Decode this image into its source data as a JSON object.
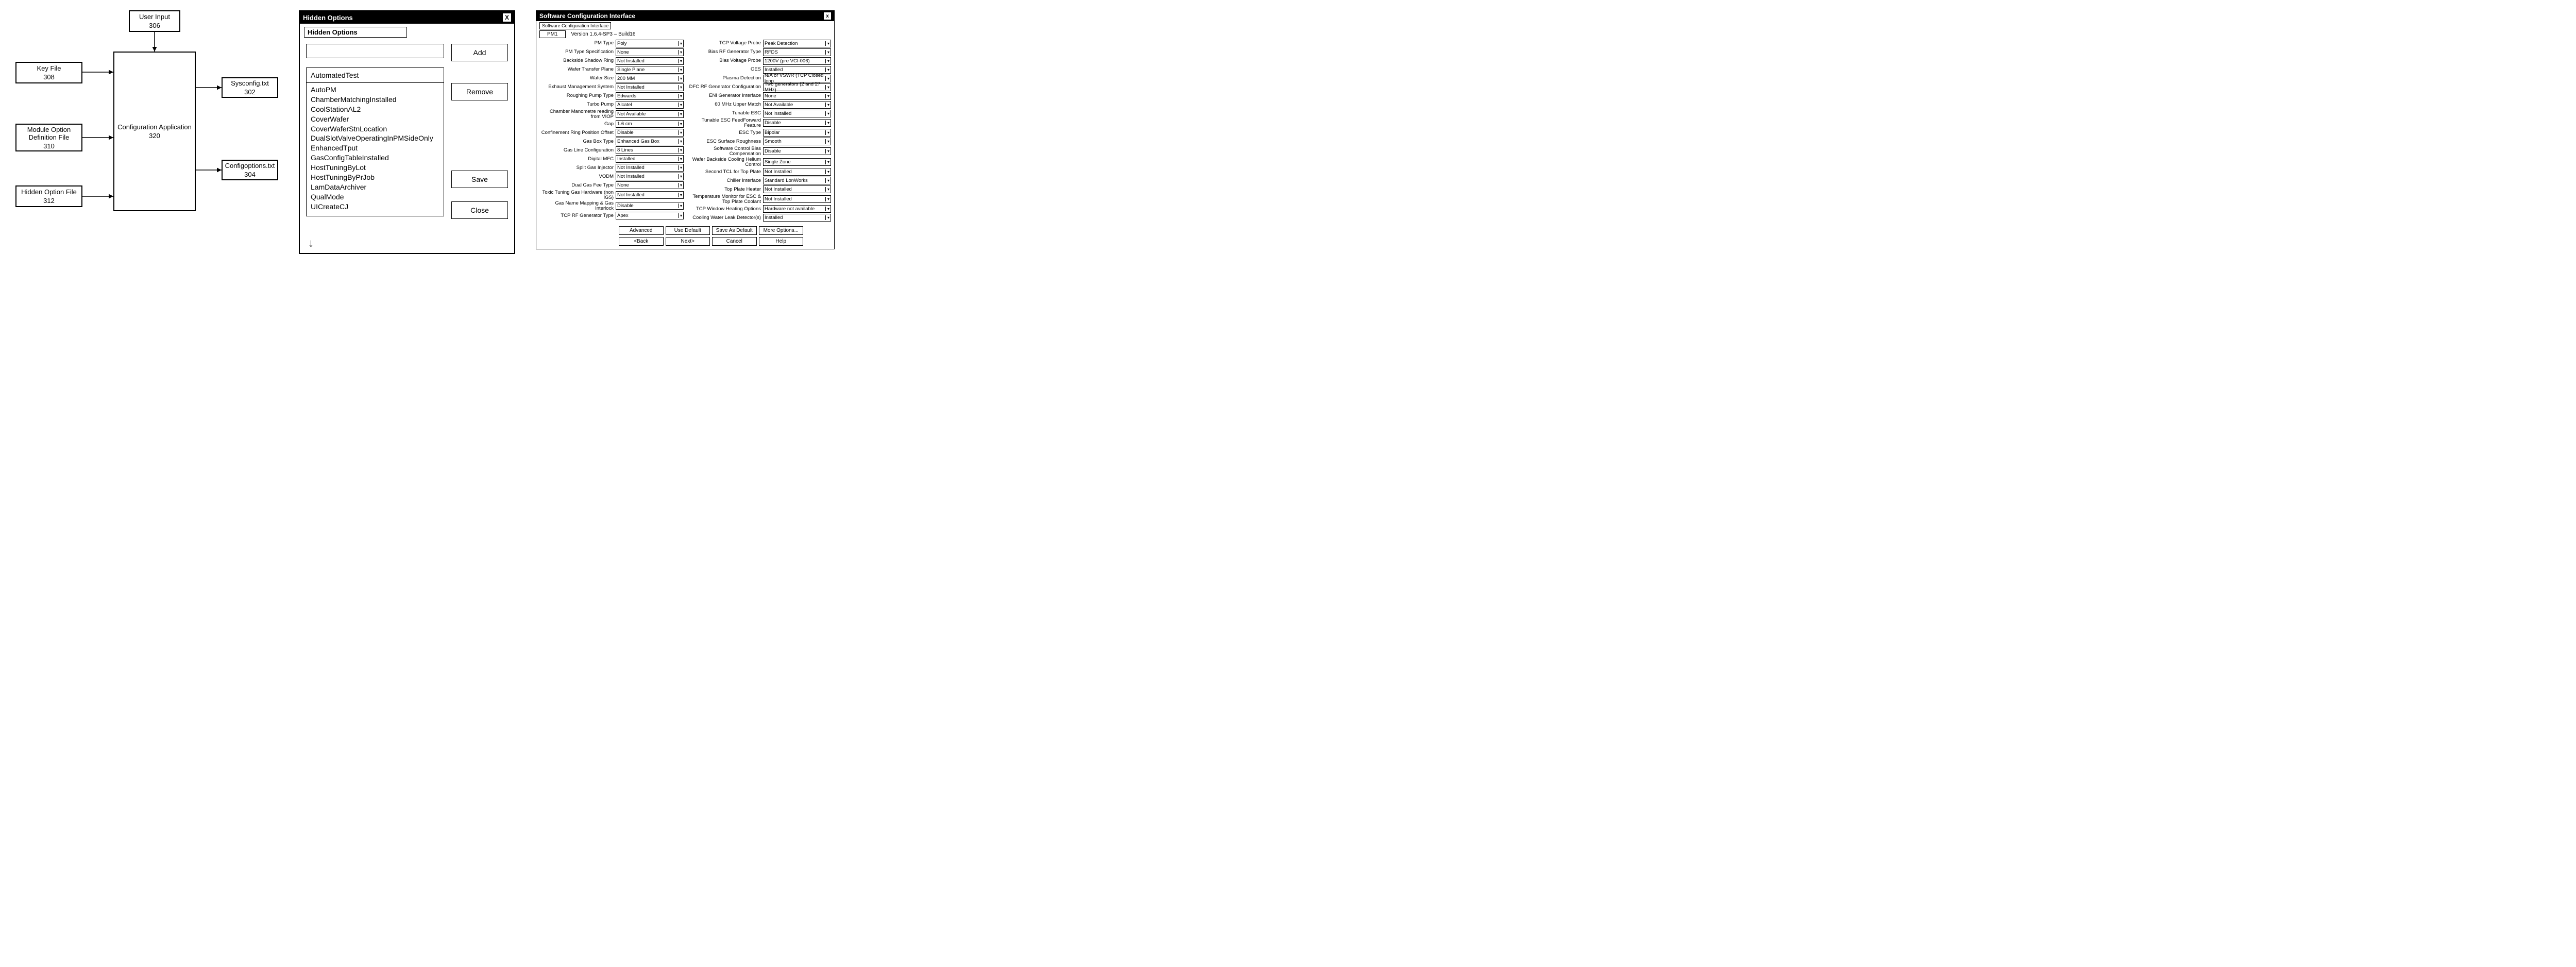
{
  "diagram": {
    "user_input": {
      "label": "User Input",
      "num": "306"
    },
    "key_file": {
      "label": "Key File",
      "num": "308"
    },
    "module_option": {
      "label": "Module Option\nDefinition File",
      "num": "310"
    },
    "hidden_option": {
      "label": "Hidden Option File",
      "num": "312"
    },
    "config_app": {
      "label": "Configuration Application",
      "num": "320"
    },
    "sysconfig": {
      "label": "Sysconfig.txt",
      "num": "302"
    },
    "configoptions": {
      "label": "Configoptions.txt",
      "num": "304"
    }
  },
  "hidden": {
    "title": "Hidden Options",
    "subtitle": "Hidden Options",
    "new_option_value": "",
    "selected": "AutomatedTest",
    "list": [
      "AutoPM",
      "ChamberMatchingInstalled",
      "CoolStationAL2",
      "CoverWafer",
      "CoverWaferStnLocation",
      "DualSlotValveOperatingInPMSideOnly",
      "EnhancedTput",
      "GasConfigTableInstalled",
      "HostTuningByLot",
      "HostTuningByPrJob",
      "LamDataArchiver",
      "QualMode",
      "UICreateCJ"
    ],
    "buttons": {
      "add": "Add",
      "remove": "Remove",
      "save": "Save",
      "close": "Close"
    }
  },
  "sci": {
    "title": "Software Configuration Interface",
    "tabbar_label": "Software Configuration Interface",
    "tab": "PM1",
    "version": "Version 1.6.4-SP3 – Build16",
    "left": [
      {
        "label": "PM Type",
        "value": "Poly"
      },
      {
        "label": "PM Type Specification",
        "value": "None"
      },
      {
        "label": "Backside Shadow Ring",
        "value": "Not Installed"
      },
      {
        "label": "Wafer Transfer Plane",
        "value": "Single Plane"
      },
      {
        "label": "Wafer Size",
        "value": "200 MM"
      },
      {
        "label": "Exhaust Management System",
        "value": "Not Installed"
      },
      {
        "label": "Roughing Pump Type",
        "value": "Edwards"
      },
      {
        "label": "Turbo Pump",
        "value": "Alcatel"
      },
      {
        "label": "Chamber Manometre reading from VIOP",
        "value": "Not Available"
      },
      {
        "label": "Gap",
        "value": "1.6 cm"
      },
      {
        "label": "Confinement Ring Position Offset",
        "value": "Disable"
      },
      {
        "label": "Gas Box Type",
        "value": "Enhanced Gas Box"
      },
      {
        "label": "Gas Line Configuration",
        "value": "8 Lines"
      },
      {
        "label": "Digital MFC",
        "value": "Installed"
      },
      {
        "label": "Split Gas Injector",
        "value": "Not Installed"
      },
      {
        "label": "VODM",
        "value": "Not Installed"
      },
      {
        "label": "Dual Gas Fee Type",
        "value": "None"
      },
      {
        "label": "Toxic Tuning Gas Hardware (non IGS)",
        "value": "Not Installed"
      },
      {
        "label": "Gas Name Mapping & Gas Interlock",
        "value": "Disable"
      },
      {
        "label": "TCP RF Generator Type",
        "value": "Apex"
      }
    ],
    "right": [
      {
        "label": "TCP Voltage Probe",
        "value": "Peak Detection"
      },
      {
        "label": "Bias RF Generator Type",
        "value": "RFDS"
      },
      {
        "label": "Bias Voltage Probe",
        "value": "1200V (pre VCI-006)"
      },
      {
        "label": "OES",
        "value": "Installed"
      },
      {
        "label": "Plasma Detection",
        "value": "N/A or VSWR (TCP Closed loop"
      },
      {
        "label": "DFC RF Generator Configuration",
        "value": "Two generators (2 and 27 MHz)"
      },
      {
        "label": "ENI Generator Interface",
        "value": "None"
      },
      {
        "label": "60 MHz Upper Match",
        "value": "Not Available"
      },
      {
        "label": "Tunable ESC",
        "value": "Not installed"
      },
      {
        "label": "Tunable ESC FeedForward Feature",
        "value": "Disable"
      },
      {
        "label": "ESC Type",
        "value": "Bipolar"
      },
      {
        "label": "ESC Surface Roughness",
        "value": "Smooth"
      },
      {
        "label": "Software Control Bias Compensation",
        "value": "Disable"
      },
      {
        "label": "Wafer Backside Cooling Helium Control",
        "value": "Single Zone"
      },
      {
        "label": "Second TCL for Top Plate",
        "value": "Not Installed"
      },
      {
        "label": "Chiller Interface",
        "value": "Standard LonWorks"
      },
      {
        "label": "Top Plate Heater",
        "value": "Not Installed"
      },
      {
        "label": "Temperature Monitor for ESC & Top Plate Coolant",
        "value": "Not Installed"
      },
      {
        "label": "TCP Window Heating Options",
        "value": "Hardware not available"
      },
      {
        "label": "Cooling Water Leak Detector(s)",
        "value": "Installed"
      }
    ],
    "buttons": {
      "advanced": "Advanced",
      "use_default": "Use Default",
      "save_default": "Save As Default",
      "more": "More Options...",
      "back": "<Back",
      "next": "Next>",
      "cancel": "Cancel",
      "help": "Help"
    }
  }
}
